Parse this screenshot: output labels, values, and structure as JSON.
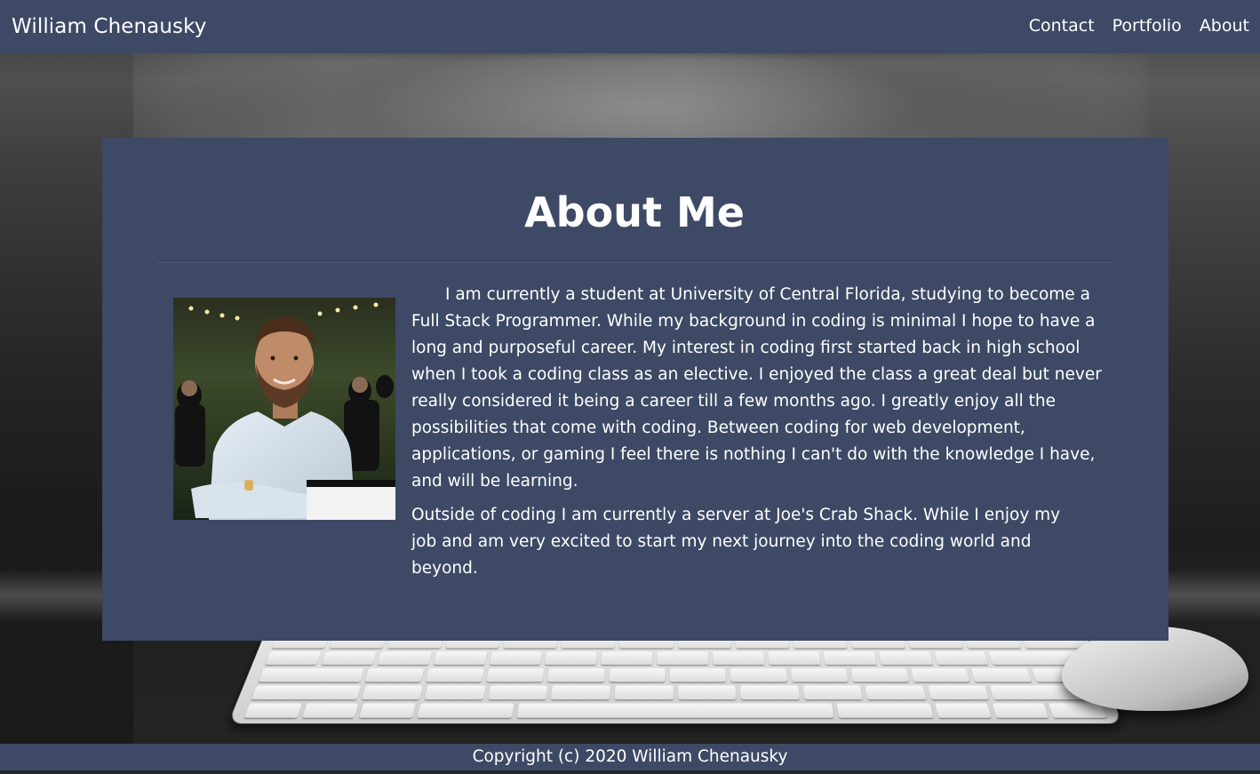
{
  "navbar": {
    "brand": "William Chenausky",
    "links": [
      {
        "label": "Contact"
      },
      {
        "label": "Portfolio"
      },
      {
        "label": "About"
      }
    ],
    "background_color": "#3d4965"
  },
  "about": {
    "title": "About Me",
    "paragraphs": [
      "I am currently a student at University of Central Florida, studying to become a Full Stack Programmer. While my background in coding is minimal I hope to have a long and purposeful career. My interest in coding first started back in high school when I took a coding class as an elective. I enjoyed the class a great deal but never really considered it being a career till a few months ago. I greatly enjoy all the possibilities that come with coding. Between coding for web development, applications, or gaming I feel there is nothing I can't do with the knowledge I have, and will be learning.",
      "Outside of coding I am currently a server at Joe's Crab Shack. While I enjoy my job and am very excited to start my next journey into the coding world and beyond."
    ],
    "card_color": "#3d4965"
  },
  "footer": {
    "text": "Copyright (c) 2020 William Chenausky"
  }
}
